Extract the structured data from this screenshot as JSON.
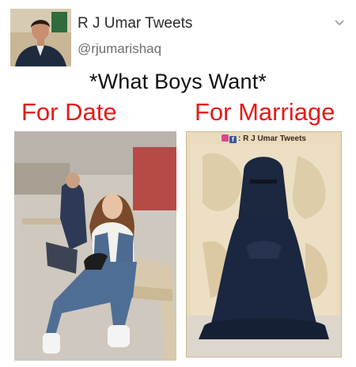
{
  "post": {
    "author_name": "R J Umar Tweets",
    "author_handle": "@rjumarishaq",
    "menu_icon": "chevron-down-icon"
  },
  "meme": {
    "title": "*What Boys Want*",
    "left_label": "For Date",
    "right_label": "For Marriage",
    "watermark_text": ": R J Umar Tweets",
    "label_color": "#e31b1b"
  }
}
